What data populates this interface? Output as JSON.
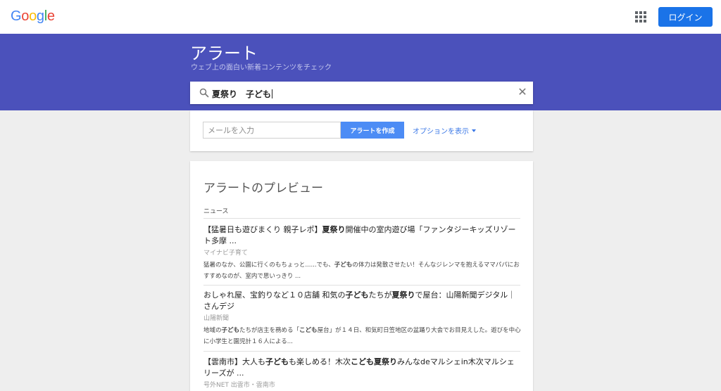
{
  "header": {
    "logo_letters": [
      {
        "ch": "G",
        "color": "#4285f4"
      },
      {
        "ch": "o",
        "color": "#ea4335"
      },
      {
        "ch": "o",
        "color": "#fbbc05"
      },
      {
        "ch": "g",
        "color": "#4285f4"
      },
      {
        "ch": "l",
        "color": "#34a853"
      },
      {
        "ch": "e",
        "color": "#ea4335"
      }
    ],
    "apps_icon": "apps-grid-icon",
    "login_label": "ログイン"
  },
  "banner": {
    "title": "アラート",
    "subtitle": "ウェブ上の面白い新着コンテンツをチェック"
  },
  "search": {
    "query": "夏祭り　子ども",
    "search_icon": "search-icon",
    "clear_icon": "close-icon"
  },
  "create_form": {
    "email_placeholder": "メールを入力",
    "create_label": "アラートを作成",
    "options_label": "オプションを表示"
  },
  "preview": {
    "title": "アラートのプレビュー",
    "section_label": "ニュース",
    "items": [
      {
        "title_html": "【猛暑日も遊びまくり 親子レポ】<b>夏祭り</b>開催中の室内遊び場「ファンタジーキッズリゾート多摩 ...",
        "source": "マイナビ子育て",
        "snippet_html": "猛暑のなか、公園に行くのもちょっと......でも、<b>子ども</b>の体力は発散させたい！そんなジレンマを抱えるママパパにおすすめなのが、室内で思いっきり ..."
      },
      {
        "title_html": "おしゃれ屋、宝釣りなど１０店舗 和気の<b>子ども</b>たちが<b>夏祭り</b>で屋台：山陽新聞デジタル｜さんデジ",
        "source": "山陽新聞",
        "snippet_html": "地域の<b>子ども</b>たちが店主を務める「<b>こども</b>屋台」が１４日、和気町日笠地区の盆踊り大会でお目見えした。遊びを中心に小学生と園児計１６人による..."
      },
      {
        "title_html": "【雲南市】大人も<b>子ども</b>も楽しめる！木次<b>こども夏祭り</b>みんなdeマルシェin木次マルシェリーズが ...",
        "source": "号外NET 出雲市・雲南市",
        "snippet_html": ""
      }
    ]
  },
  "colors": {
    "banner": "#4b51bb",
    "primary_button": "#1a73e8",
    "create_button": "#4c8cf5",
    "link": "#3b78e7",
    "page_bg": "#eeeeee"
  }
}
